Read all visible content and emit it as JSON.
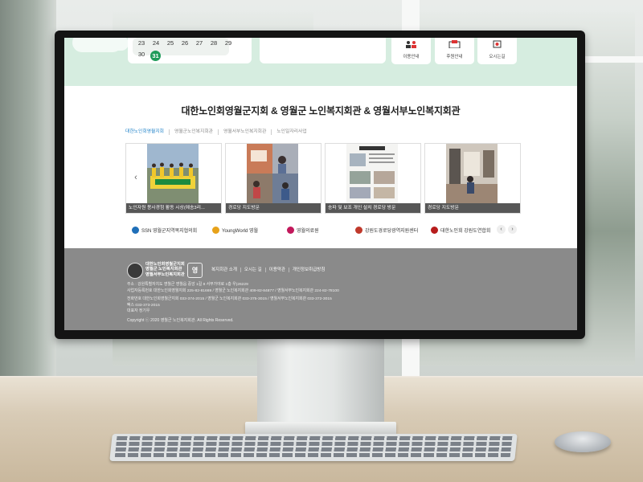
{
  "calendar": {
    "row1": [
      "23",
      "24",
      "25",
      "26",
      "27",
      "28",
      "29"
    ],
    "row2": [
      "30",
      "31"
    ],
    "today": "31"
  },
  "quick_links": [
    {
      "label": "이용안내",
      "icon": "user-group-icon"
    },
    {
      "label": "후원안내",
      "icon": "donation-icon"
    },
    {
      "label": "오시는길",
      "icon": "map-pin-icon"
    }
  ],
  "page_title": "대한노인회영월군지회 & 영월군 노인복지회관 & 영월서부노인복지회관",
  "tabs": [
    {
      "label": "대한노인회영월지회",
      "active": true
    },
    {
      "label": "영월군노인복지회관",
      "active": false
    },
    {
      "label": "영월서부노인복지회관",
      "active": false
    },
    {
      "label": "노인일자리사업",
      "active": false
    }
  ],
  "gallery": [
    {
      "caption": "노인자원 봉사경험 활동 시상(예송3리..."
    },
    {
      "caption": "경로당 지도방문"
    },
    {
      "caption": "송파 및 보조 개인 설치 경로당 방문"
    },
    {
      "caption": "경로당 지도방문"
    }
  ],
  "gallery_nav": {
    "prev": "‹",
    "next": "›"
  },
  "partners": [
    {
      "label": "SSN 영월군지역복지협의회",
      "color": "#1f6fb8"
    },
    {
      "label": "YoungWorld 영월",
      "color": "#e7a21a"
    },
    {
      "label": "영월의료원",
      "color": "#c2185b"
    },
    {
      "label": "강원도경로당광역지원센터",
      "color": "#c0392b"
    },
    {
      "label": "대한노인회 강원도연합회",
      "color": "#b71c1c"
    }
  ],
  "partner_nav": {
    "prev": "‹",
    "next": "›"
  },
  "footer": {
    "org_lines": [
      "대한노인회영월군지회",
      "영월군 노인복지회관",
      "영월서부노인복지회관"
    ],
    "badge": "영",
    "links": [
      "복지회관 소개",
      "오시는 길",
      "이용약관",
      "개인정보취급방침"
    ],
    "address": "주소 : 강원특별자치도 영월군 영월읍 중앙 1길 8 서부가야로 1층 우)26229",
    "business": "사업자등록번호 대한노인회영월지회 225-82-81669 / 영월군 노인복지회관 409-82-84877 / 영월서부노인복지회관 224-82-78100",
    "phone": "전화번호 대한노인회영월군지회 033-374-2015 / 영월군 노인복지회관 033-375-3015 / 영월서부노인복지회관 033-372-3015",
    "fax": "팩스 033-373-2015",
    "rep": "대표자 정기우",
    "copyright": "Copyright ⓒ 2020 영월군 노인복지회관. All Rights Reserved."
  },
  "colors": {
    "mint": "#d6ede0",
    "accent_green": "#1f9b5a",
    "tab_active": "#1a7fc7",
    "footer_bg": "#8a8a8a"
  }
}
